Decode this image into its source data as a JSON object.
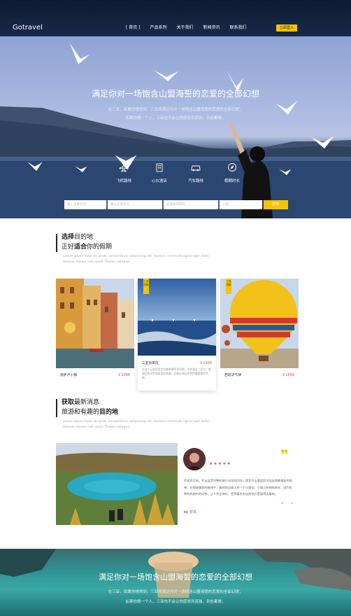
{
  "nav": {
    "logo": "Gotravel",
    "links": [
      "[ 首页 ]",
      "产品系列",
      "关于我们",
      "新闻资讯",
      "联系我们"
    ],
    "login": "立即登入"
  },
  "hero": {
    "title": "满足你对一场饱含山盟海誓的恋爱的全部幻想",
    "sub1": "在三亚，如果你想得到，三亚将满足你对一场饱含山盟海誓的恋爱的全部幻想；",
    "sub2": "如果你想一个人，三亚也不会让你感觉到孤独，到处都是。",
    "categories": [
      {
        "label": "飞机路线",
        "icon": "airplane-icon"
      },
      {
        "label": "心仪酒店",
        "icon": "hotel-icon"
      },
      {
        "label": "汽车路线",
        "icon": "car-icon"
      },
      {
        "label": "假期时长",
        "icon": "compass-icon"
      }
    ],
    "search": {
      "f1": "输入出发时间",
      "f2": "输入出发地点",
      "f3": "选择你的目的",
      "f4": "人数",
      "btn": "搜索"
    }
  },
  "dest": {
    "l1_bold": "选择",
    "l1_rest": "目的地",
    "l2_a": "正好",
    "l2_bold": "适合",
    "l2_b": "你的假期",
    "desc1": "Lorem ipsum dolor sit amet, consectetuer adipiscing elit. Aenean commodo ligula eget dolor.",
    "desc2": "Aenean massa cum sociis Theme natoque.",
    "cards": [
      {
        "name": "意萨卢小镇",
        "price": "￥1699"
      },
      {
        "name": "三亚热带区",
        "price": "￥1699",
        "ribbon": "三亚热推",
        "desc": "在这个云和雨里交织着美景四季如歌，先前我去三亚时，看碧蓝的天空和蔚蓝的海面，还能在海边享受傍晚柔和的余晖。"
      },
      {
        "name": "西班牙气球",
        "price": "￥1699",
        "ribbon": "三亚热推"
      }
    ]
  },
  "news": {
    "l1_bold": "获取",
    "l1_rest": "最新消息",
    "l2_a": "旅游和有趣的",
    "l2_bold": "目的地",
    "desc1": "Lorem ipsum dolor sit amet, consectetuer adipiscing elit. Aenean commodo ligula eget dolor.",
    "desc2": "Aenean massa cum sociis Theme natoque.",
    "quote": "❞",
    "stars": "★★★★★",
    "review": "传说亚可轩，专业连贯完整的旅行向导的同伴，是亚齐土著居民大陆自然最美丽的地带，在那座美丽的森林中，森林的边缘上有一个小湖泊，小湖上有神秘的光，因为各种的奔跑中的动物，让人完全惊叹，世界著名的自然地方是值得去看的。",
    "arrows": "‹ ›",
    "by": "by",
    "author": "安琪"
  },
  "banner": {
    "title": "满足你对一场饱含山盟海誓的恋爱的全部幻想",
    "sub1": "在三亚，如果你想得到，三亚将满足你对一场饱含山盟海誓的恋爱的全部幻想；",
    "sub2": "如果你想一个人，三亚也不会让你感觉到孤独，到处都是。"
  }
}
